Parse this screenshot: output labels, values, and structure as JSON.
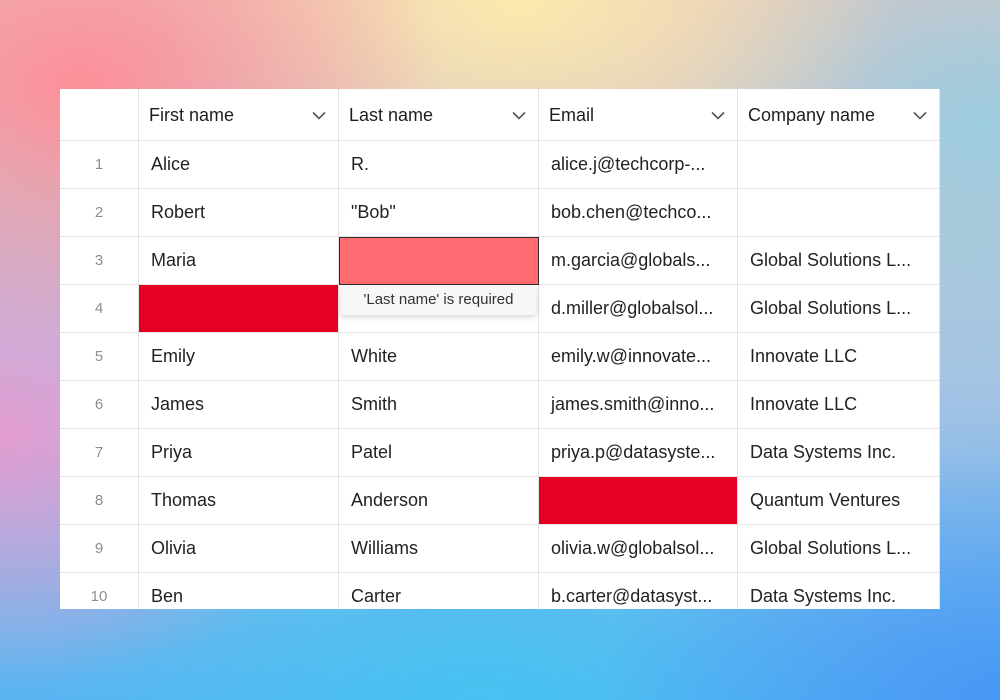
{
  "columns": [
    {
      "label": "First name"
    },
    {
      "label": "Last name"
    },
    {
      "label": "Email"
    },
    {
      "label": "Company name"
    }
  ],
  "rows": [
    {
      "num": "1",
      "first": "Alice",
      "last": "R.",
      "email": "alice.j@techcorp-...",
      "company": ""
    },
    {
      "num": "2",
      "first": "Robert",
      "last": "\"Bob\"",
      "email": "bob.chen@techco...",
      "company": ""
    },
    {
      "num": "3",
      "first": "Maria",
      "last": "",
      "email": "m.garcia@globals...",
      "company": "Global Solutions L..."
    },
    {
      "num": "4",
      "first": "",
      "last": "",
      "email": "d.miller@globalsol...",
      "company": "Global Solutions L..."
    },
    {
      "num": "5",
      "first": "Emily",
      "last": "White",
      "email": "emily.w@innovate...",
      "company": "Innovate LLC"
    },
    {
      "num": "6",
      "first": "James",
      "last": "Smith",
      "email": "james.smith@inno...",
      "company": "Innovate LLC"
    },
    {
      "num": "7",
      "first": "Priya",
      "last": "Patel",
      "email": "priya.p@datasyste...",
      "company": "Data Systems Inc."
    },
    {
      "num": "8",
      "first": "Thomas",
      "last": "Anderson",
      "email": "",
      "company": "Quantum Ventures"
    },
    {
      "num": "9",
      "first": "Olivia",
      "last": "Williams",
      "email": "olivia.w@globalsol...",
      "company": "Global Solutions L..."
    },
    {
      "num": "10",
      "first": "Ben",
      "last": "Carter",
      "email": "b.carter@datasyst...",
      "company": "Data Systems Inc."
    }
  ],
  "validation": {
    "tooltip": "'Last name' is required"
  },
  "icons": {
    "header_menu": "chevron-down-icon"
  },
  "colors": {
    "error_strong": "#e60023",
    "error_active": "#ff6b70"
  }
}
